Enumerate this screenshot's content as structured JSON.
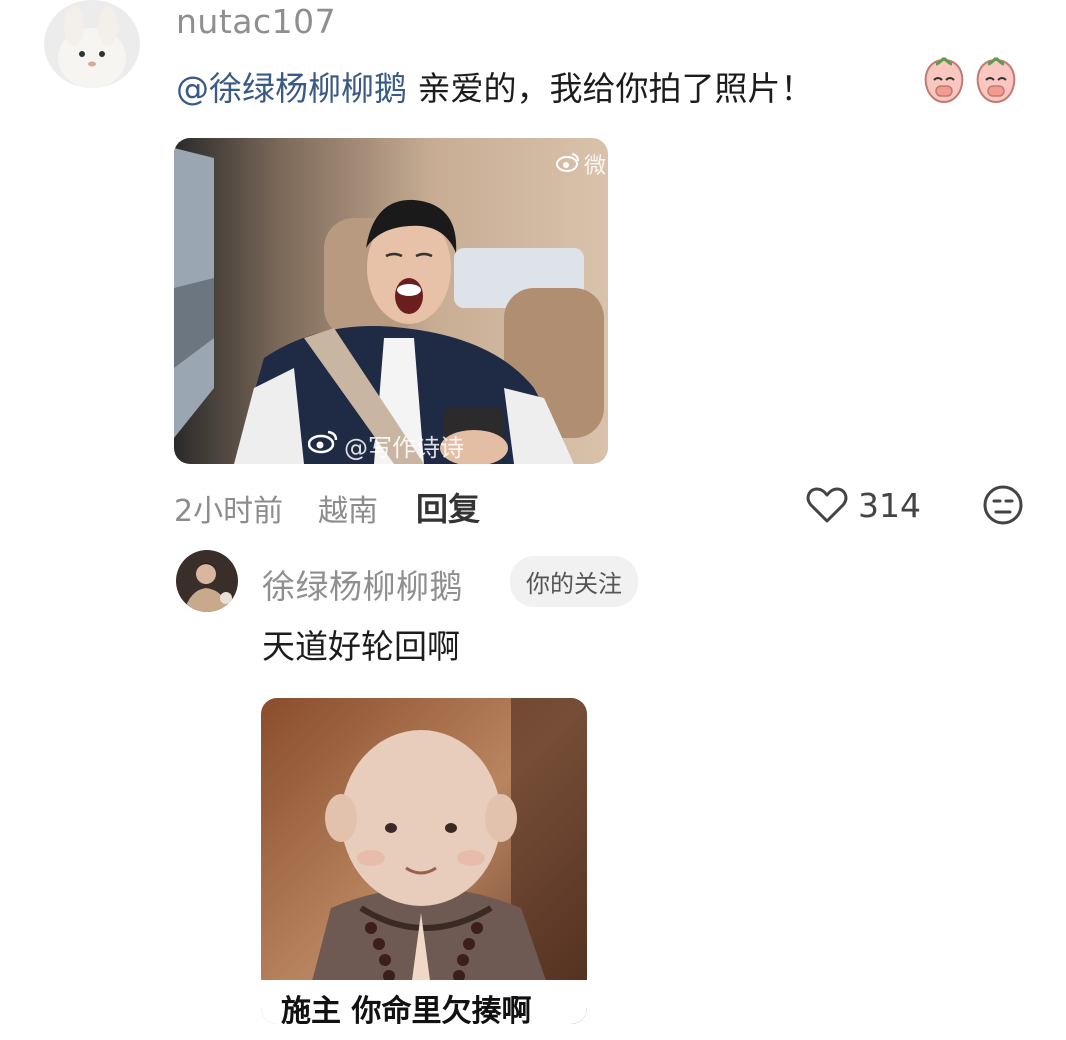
{
  "comment": {
    "username": "nutac107",
    "mention": "@徐绿杨柳柳鹅",
    "text": " 亲爱的，我给你拍了照片！",
    "emojis": [
      "peach-cover-face-icon",
      "peach-cover-face-icon"
    ],
    "image": {
      "watermark_top": "微",
      "watermark_bottom": "@写作诗诗"
    },
    "time": "2小时前",
    "location": "越南",
    "reply_label": "回复",
    "likes": "314"
  },
  "reply": {
    "username": "徐绿杨柳柳鹅",
    "badge": "你的关注",
    "text": "天道好轮回啊",
    "image": {
      "caption": "施主 你命里欠揍啊"
    }
  },
  "colors": {
    "mention": "#3a5a86",
    "username": "#8f8f8f",
    "badge_bg": "#f1f1f1"
  }
}
